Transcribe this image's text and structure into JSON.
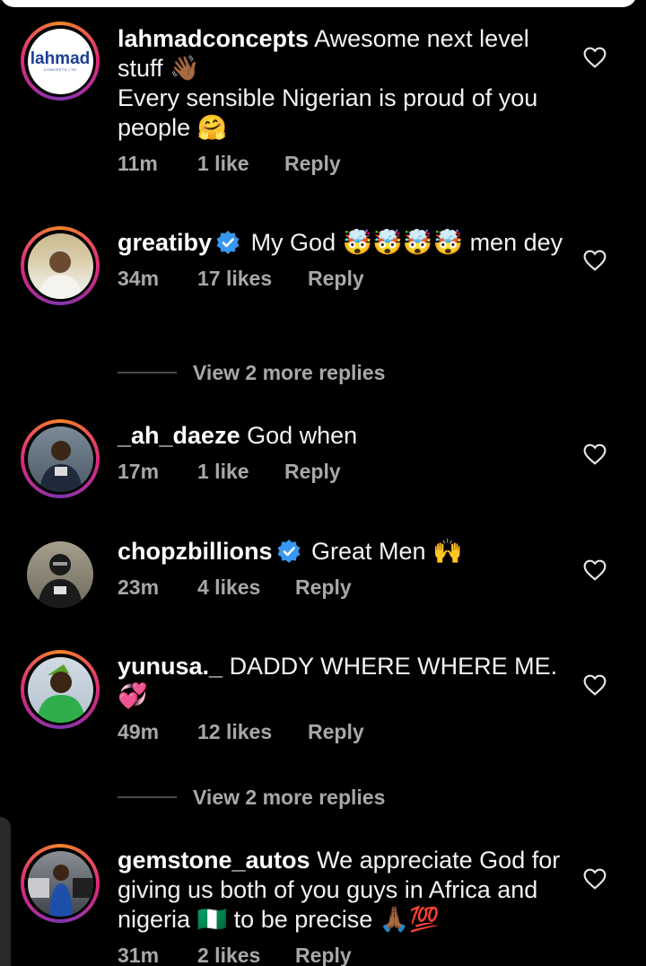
{
  "comments": [
    {
      "username": "lahmadconcepts",
      "verified": false,
      "text": "Awesome next level stuff 👋🏾",
      "text2": "Every sensible Nigerian is proud of you people 🤗",
      "time": "11m",
      "likes": "1 like",
      "reply": "Reply",
      "avatar_logo": "lahmad",
      "avatar_logo_sub": "CONCEPTS LTD"
    },
    {
      "username": "greatiby",
      "verified": true,
      "text": "My God 🤯🤯🤯🤯 men dey",
      "time": "34m",
      "likes": "17 likes",
      "reply": "Reply",
      "more_replies": "View 2 more replies"
    },
    {
      "username": "_ah_daeze",
      "verified": false,
      "text": "God when",
      "time": "17m",
      "likes": "1 like",
      "reply": "Reply"
    },
    {
      "username": "chopzbillions",
      "verified": true,
      "text": "Great Men 🙌",
      "time": "23m",
      "likes": "4 likes",
      "reply": "Reply"
    },
    {
      "username": "yunusa._",
      "verified": false,
      "text": "DADDY WHERE WHERE ME. 💞",
      "time": "49m",
      "likes": "12 likes",
      "reply": "Reply",
      "more_replies": "View 2 more replies"
    },
    {
      "username": "gemstone_autos",
      "verified": false,
      "text": "We appreciate God for giving us both of you guys in Africa and nigeria 🇳🇬 to be precise 🙏🏾💯",
      "time": "31m",
      "likes": "2 likes",
      "reply": "Reply"
    }
  ],
  "colors": {
    "background": "#000000",
    "meta_text": "#a8a8a8",
    "verified_badge": "#3897f0",
    "story_ring": "#dd2a7b"
  },
  "icons": {
    "like": "heart-outline-icon",
    "verified": "verified-badge-icon"
  }
}
